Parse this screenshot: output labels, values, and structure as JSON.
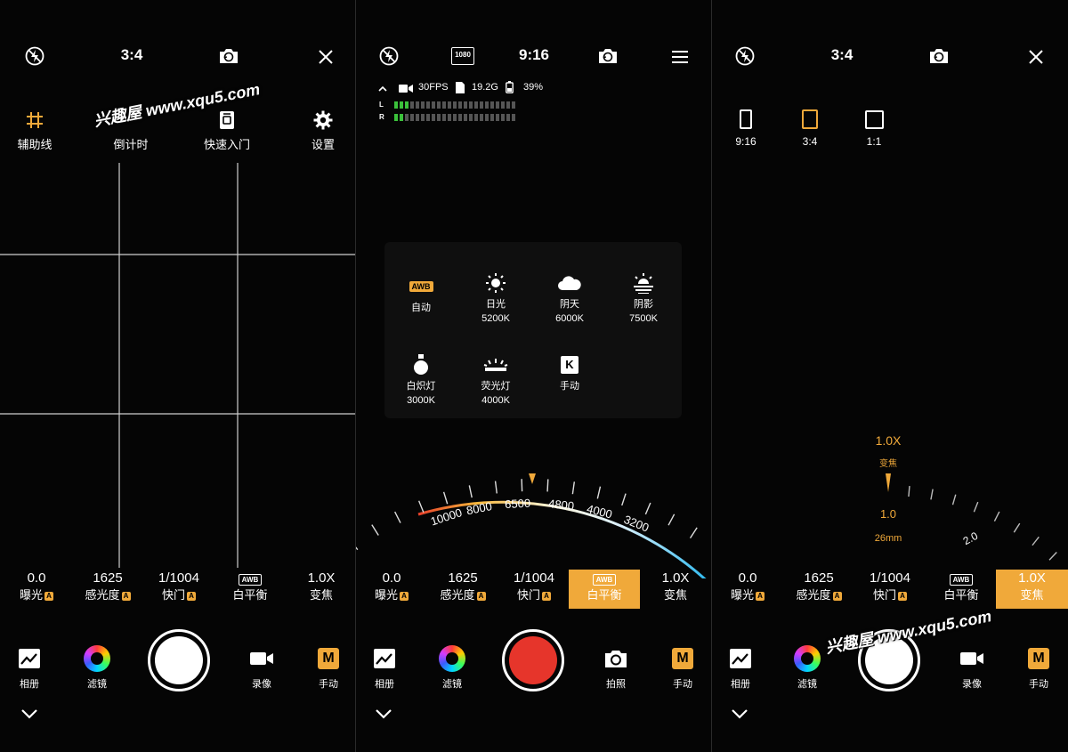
{
  "watermark": "兴趣屋 www.xqu5.com",
  "panel1": {
    "top_bar": {
      "ratio": "3:4"
    },
    "settings_menu": [
      {
        "icon": "grid-icon",
        "label": "辅助线"
      },
      {
        "icon": "timer-icon",
        "label": "倒计时"
      },
      {
        "icon": "quick-start-icon",
        "label": "快速入门"
      },
      {
        "icon": "gear-icon",
        "label": "设置"
      }
    ]
  },
  "panel2": {
    "top_bar": {
      "resolution": "1080",
      "ratio": "9:16"
    },
    "status": {
      "fps": "30FPS",
      "storage": "19.2G",
      "battery": "39%"
    },
    "audio_meter": {
      "left_label": "L",
      "right_label": "R",
      "left_level": 0.15,
      "right_level": 0.1
    },
    "white_balance": [
      {
        "icon": "awb-icon",
        "badge": "AWB",
        "label": "自动",
        "value": "",
        "selected": true
      },
      {
        "icon": "sun-icon",
        "label": "日光",
        "value": "5200K"
      },
      {
        "icon": "cloud-icon",
        "label": "阴天",
        "value": "6000K"
      },
      {
        "icon": "shade-icon",
        "label": "阴影",
        "value": "7500K"
      },
      {
        "icon": "bulb-icon",
        "label": "白炽灯",
        "value": "3000K"
      },
      {
        "icon": "fluorescent-icon",
        "label": "荧光灯",
        "value": "4000K"
      },
      {
        "icon": "kelvin-icon",
        "badge": "K",
        "label": "手动",
        "value": ""
      }
    ],
    "dial_labels": [
      "10000",
      "8000",
      "6500",
      "4800",
      "4000",
      "3200"
    ]
  },
  "panel3": {
    "top_bar": {
      "ratio": "3:4"
    },
    "ratio_options": [
      {
        "label": "9:16",
        "selected": false
      },
      {
        "label": "3:4",
        "selected": true
      },
      {
        "label": "1:1",
        "selected": false
      }
    ],
    "zoom": {
      "current": "1.0X",
      "current_label": "变焦",
      "tick_value": "1.0",
      "focal": "26mm",
      "next": "2.0"
    }
  },
  "params": {
    "exposure": {
      "value": "0.0",
      "label": "曝光"
    },
    "iso": {
      "value": "1625",
      "label": "感光度"
    },
    "shutter": {
      "value": "1/1004",
      "label": "快门"
    },
    "wb": {
      "badge": "AWB",
      "label": "白平衡"
    },
    "zoom": {
      "value": "1.0X",
      "label": "变焦"
    },
    "auto_badge": "A"
  },
  "bottom": {
    "gallery": "相册",
    "filter": "滤镜",
    "record": "录像",
    "photo": "拍照",
    "manual": "手动",
    "manual_badge": "M"
  },
  "colors": {
    "accent": "#f0a93a",
    "record": "#e6352b"
  }
}
